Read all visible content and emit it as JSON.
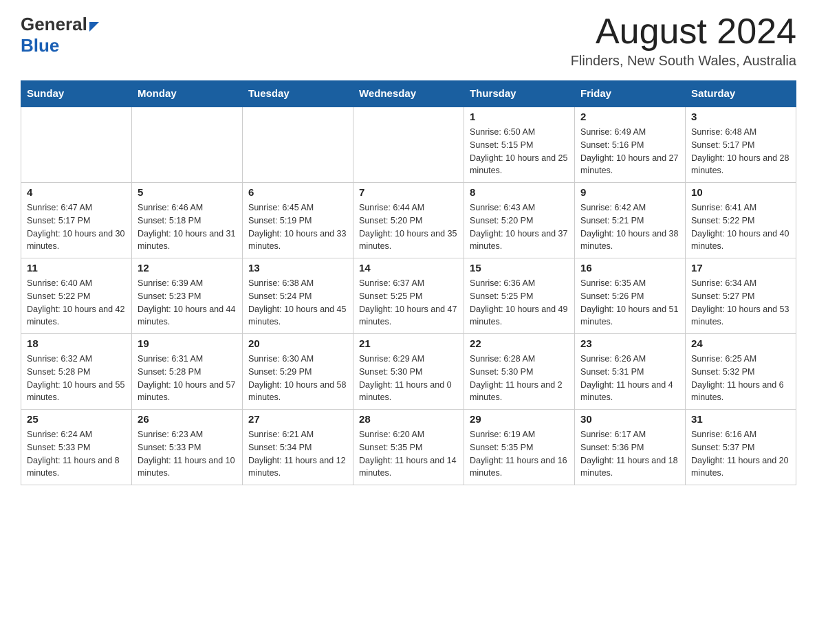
{
  "header": {
    "logo_general": "General",
    "logo_blue": "Blue",
    "month_title": "August 2024",
    "subtitle": "Flinders, New South Wales, Australia"
  },
  "days_of_week": [
    "Sunday",
    "Monday",
    "Tuesday",
    "Wednesday",
    "Thursday",
    "Friday",
    "Saturday"
  ],
  "weeks": [
    [
      {
        "day": "",
        "info": ""
      },
      {
        "day": "",
        "info": ""
      },
      {
        "day": "",
        "info": ""
      },
      {
        "day": "",
        "info": ""
      },
      {
        "day": "1",
        "info": "Sunrise: 6:50 AM\nSunset: 5:15 PM\nDaylight: 10 hours and 25 minutes."
      },
      {
        "day": "2",
        "info": "Sunrise: 6:49 AM\nSunset: 5:16 PM\nDaylight: 10 hours and 27 minutes."
      },
      {
        "day": "3",
        "info": "Sunrise: 6:48 AM\nSunset: 5:17 PM\nDaylight: 10 hours and 28 minutes."
      }
    ],
    [
      {
        "day": "4",
        "info": "Sunrise: 6:47 AM\nSunset: 5:17 PM\nDaylight: 10 hours and 30 minutes."
      },
      {
        "day": "5",
        "info": "Sunrise: 6:46 AM\nSunset: 5:18 PM\nDaylight: 10 hours and 31 minutes."
      },
      {
        "day": "6",
        "info": "Sunrise: 6:45 AM\nSunset: 5:19 PM\nDaylight: 10 hours and 33 minutes."
      },
      {
        "day": "7",
        "info": "Sunrise: 6:44 AM\nSunset: 5:20 PM\nDaylight: 10 hours and 35 minutes."
      },
      {
        "day": "8",
        "info": "Sunrise: 6:43 AM\nSunset: 5:20 PM\nDaylight: 10 hours and 37 minutes."
      },
      {
        "day": "9",
        "info": "Sunrise: 6:42 AM\nSunset: 5:21 PM\nDaylight: 10 hours and 38 minutes."
      },
      {
        "day": "10",
        "info": "Sunrise: 6:41 AM\nSunset: 5:22 PM\nDaylight: 10 hours and 40 minutes."
      }
    ],
    [
      {
        "day": "11",
        "info": "Sunrise: 6:40 AM\nSunset: 5:22 PM\nDaylight: 10 hours and 42 minutes."
      },
      {
        "day": "12",
        "info": "Sunrise: 6:39 AM\nSunset: 5:23 PM\nDaylight: 10 hours and 44 minutes."
      },
      {
        "day": "13",
        "info": "Sunrise: 6:38 AM\nSunset: 5:24 PM\nDaylight: 10 hours and 45 minutes."
      },
      {
        "day": "14",
        "info": "Sunrise: 6:37 AM\nSunset: 5:25 PM\nDaylight: 10 hours and 47 minutes."
      },
      {
        "day": "15",
        "info": "Sunrise: 6:36 AM\nSunset: 5:25 PM\nDaylight: 10 hours and 49 minutes."
      },
      {
        "day": "16",
        "info": "Sunrise: 6:35 AM\nSunset: 5:26 PM\nDaylight: 10 hours and 51 minutes."
      },
      {
        "day": "17",
        "info": "Sunrise: 6:34 AM\nSunset: 5:27 PM\nDaylight: 10 hours and 53 minutes."
      }
    ],
    [
      {
        "day": "18",
        "info": "Sunrise: 6:32 AM\nSunset: 5:28 PM\nDaylight: 10 hours and 55 minutes."
      },
      {
        "day": "19",
        "info": "Sunrise: 6:31 AM\nSunset: 5:28 PM\nDaylight: 10 hours and 57 minutes."
      },
      {
        "day": "20",
        "info": "Sunrise: 6:30 AM\nSunset: 5:29 PM\nDaylight: 10 hours and 58 minutes."
      },
      {
        "day": "21",
        "info": "Sunrise: 6:29 AM\nSunset: 5:30 PM\nDaylight: 11 hours and 0 minutes."
      },
      {
        "day": "22",
        "info": "Sunrise: 6:28 AM\nSunset: 5:30 PM\nDaylight: 11 hours and 2 minutes."
      },
      {
        "day": "23",
        "info": "Sunrise: 6:26 AM\nSunset: 5:31 PM\nDaylight: 11 hours and 4 minutes."
      },
      {
        "day": "24",
        "info": "Sunrise: 6:25 AM\nSunset: 5:32 PM\nDaylight: 11 hours and 6 minutes."
      }
    ],
    [
      {
        "day": "25",
        "info": "Sunrise: 6:24 AM\nSunset: 5:33 PM\nDaylight: 11 hours and 8 minutes."
      },
      {
        "day": "26",
        "info": "Sunrise: 6:23 AM\nSunset: 5:33 PM\nDaylight: 11 hours and 10 minutes."
      },
      {
        "day": "27",
        "info": "Sunrise: 6:21 AM\nSunset: 5:34 PM\nDaylight: 11 hours and 12 minutes."
      },
      {
        "day": "28",
        "info": "Sunrise: 6:20 AM\nSunset: 5:35 PM\nDaylight: 11 hours and 14 minutes."
      },
      {
        "day": "29",
        "info": "Sunrise: 6:19 AM\nSunset: 5:35 PM\nDaylight: 11 hours and 16 minutes."
      },
      {
        "day": "30",
        "info": "Sunrise: 6:17 AM\nSunset: 5:36 PM\nDaylight: 11 hours and 18 minutes."
      },
      {
        "day": "31",
        "info": "Sunrise: 6:16 AM\nSunset: 5:37 PM\nDaylight: 11 hours and 20 minutes."
      }
    ]
  ]
}
